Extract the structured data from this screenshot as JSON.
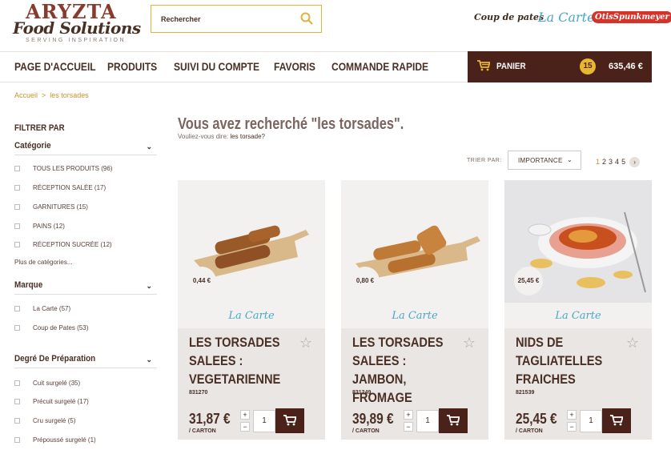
{
  "header": {
    "logo_line1": "ARYZTA",
    "logo_line2": "Food Solutions",
    "logo_tagline": "SERVING INSPIRATION",
    "search_placeholder": "Rechercher",
    "brands": [
      "Coup de pates",
      "La Carte",
      "OtisSpunkmeyer"
    ]
  },
  "nav": {
    "items": [
      "PAGE D'ACCUEIL",
      "PRODUITS",
      "SUIVI DU COMPTE",
      "FAVORIS",
      "COMMANDE RAPIDE"
    ],
    "cart_label": "PANIER",
    "cart_count": "15",
    "cart_total": "635,46 €"
  },
  "breadcrumb": {
    "home": "Accueil",
    "sep": ">",
    "current": "les torsades"
  },
  "sidebar": {
    "title": "FILTRER PAR",
    "facets": [
      {
        "label": "Catégorie",
        "options": [
          "TOUS LES PRODUITS (96)",
          "RÉCEPTION SALÉE (17)",
          "GARNITURES (15)",
          "PAINS (12)",
          "RÉCEPTION SUCRÉE (12)"
        ],
        "more": "Plus de catégories..."
      },
      {
        "label": "Marque",
        "options": [
          "La Carte (57)",
          "Coup de Pates (53)"
        ]
      },
      {
        "label": "Degré De Préparation",
        "options": [
          "Cuit surgelé (35)",
          "Précuit surgelé (17)",
          "Cru surgelé (5)",
          "Prépoussé surgelé (1)"
        ]
      }
    ]
  },
  "results": {
    "title": "Vous avez recherché \"les torsades\".",
    "didyou_prefix": "Vouliez-vous dire:",
    "didyou_link": "les torsade?",
    "sort_label": "TRIER PAR:",
    "sort_value": "IMPORTANCE",
    "pages": [
      "1",
      "2",
      "3",
      "4",
      "5"
    ]
  },
  "products": [
    {
      "name": "LES TORSADES SALEES : VEGETARIENNE",
      "code": "831270",
      "unit_price": "0,44 €",
      "brand": "La Carte",
      "price": "31,87 €",
      "unit": "/ CARTON",
      "qty": "1"
    },
    {
      "name": "LES TORSADES SALEES : JAMBON, FROMAGE",
      "code": "831249",
      "unit_price": "0,80 €",
      "brand": "La Carte",
      "price": "39,89 €",
      "unit": "/ CARTON",
      "qty": "1"
    },
    {
      "name": "NIDS DE TAGLIATELLES FRAICHES",
      "code": "821539",
      "unit_price": "25,45 €",
      "brand": "La Carte",
      "price": "25,45 €",
      "unit": "/ CARTON",
      "qty": "1"
    }
  ],
  "colors": {
    "accent": "#e0b23a",
    "dark_brown": "#4a2219",
    "text": "#4a2f25",
    "brand_blue": "#4aa7c8"
  }
}
